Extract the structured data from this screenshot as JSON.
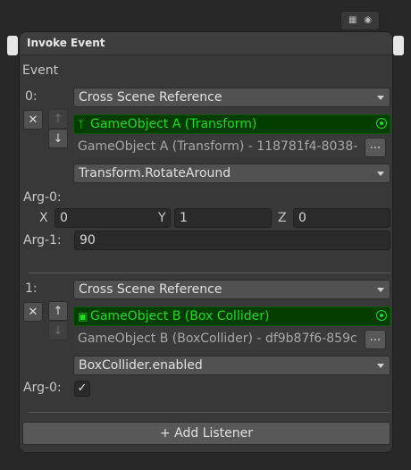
{
  "window": {
    "title": "Invoke Event"
  },
  "top_buttons": {
    "script_icon": "script-icon",
    "target_icon": "target-icon"
  },
  "event_label": "Event",
  "listeners": [
    {
      "index_label": "0:",
      "mode": "Cross Scene Reference",
      "object_name": "GameObject A (Transform)",
      "object_icon": "transform-icon",
      "reference_text": "GameObject A (Transform) - 118781f4-8038-",
      "reference_button": "...",
      "method": "Transform.RotateAround",
      "arg0_label": "Arg-0:",
      "vector": {
        "x_label": "X",
        "x": "0",
        "y_label": "Y",
        "y": "1",
        "z_label": "Z",
        "z": "0"
      },
      "arg1_label": "Arg-1:",
      "arg1_value": "90"
    },
    {
      "index_label": "1:",
      "mode": "Cross Scene Reference",
      "object_name": "GameObject B (Box Collider)",
      "object_icon": "cube-icon",
      "reference_text": "GameObject B (BoxCollider) - df9b87f6-859c",
      "reference_button": "...",
      "method": "BoxCollider.enabled",
      "arg0_label": "Arg-0:",
      "arg0_checked": true
    }
  ],
  "add_listener_label": "+ Add Listener",
  "colors": {
    "panel": "#383838",
    "object_field_bg": "#033d00",
    "object_field_text": "#2bd42b"
  }
}
